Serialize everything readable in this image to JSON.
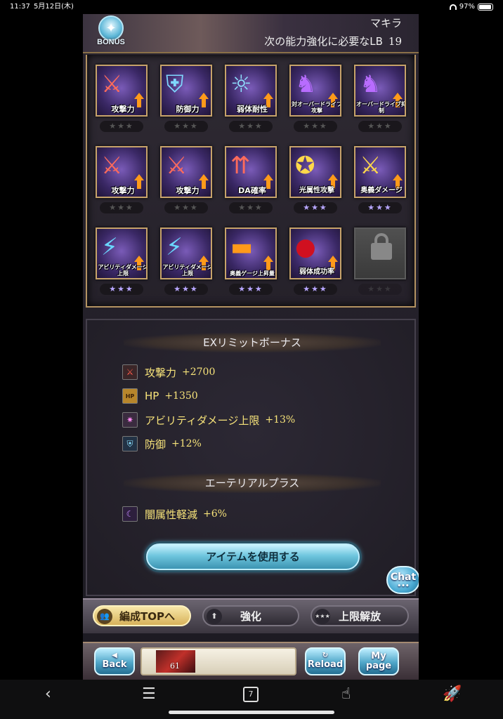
{
  "status_bar": {
    "time": "11:37",
    "date": "5月12日(木)",
    "battery": "97%",
    "battery_level": 0.97
  },
  "header": {
    "bonus_badge": "BONUS",
    "character_name": "マキラ",
    "lb_need_label": "次の能力強化に必要なLB",
    "lb_need_value": "19"
  },
  "skills": {
    "row1": [
      {
        "label": "攻撃力",
        "icon": "sword-icon",
        "stars": "★★★",
        "active": false
      },
      {
        "label": "防御力",
        "icon": "shield-icon",
        "stars": "★★★",
        "active": false
      },
      {
        "label": "弱体耐性",
        "icon": "resist-icon",
        "stars": "★★★",
        "active": false
      },
      {
        "label": "対オーバードライブ攻撃",
        "icon": "overdrive-attack-icon",
        "stars": "★★★",
        "active": false
      },
      {
        "label": "オーバードライブ抑制",
        "icon": "overdrive-suppress-icon",
        "stars": "★★★",
        "active": false
      }
    ],
    "row2": [
      {
        "label": "攻撃力",
        "icon": "sword-icon",
        "stars": "★★★",
        "active": false
      },
      {
        "label": "攻撃力",
        "icon": "sword-icon",
        "stars": "★★★",
        "active": false
      },
      {
        "label": "DA確率",
        "icon": "double-attack-icon",
        "stars": "★★★",
        "active": false
      },
      {
        "label": "光属性攻撃",
        "icon": "light-element-icon",
        "stars": "★★★",
        "active": true
      },
      {
        "label": "奥義ダメージ",
        "icon": "crossed-swords-icon",
        "stars": "★★★",
        "active": true
      }
    ],
    "row3": [
      {
        "label": "アビリティダメージ上限",
        "icon": "ability-damage-icon",
        "stars": "★★★",
        "active": true
      },
      {
        "label": "アビリティダメージ上限",
        "icon": "ability-damage-icon",
        "stars": "★★★",
        "active": true
      },
      {
        "label": "奥義ゲージ上昇量",
        "icon": "gauge-icon",
        "stars": "★★★",
        "active": true
      },
      {
        "label": "弱体成功率",
        "icon": "debuff-success-icon",
        "stars": "★★★",
        "active": true
      },
      {
        "label": "",
        "icon": "lock-icon",
        "stars": "★★★",
        "active": false,
        "locked": true
      }
    ]
  },
  "ex_bonus": {
    "title": "EXリミットボーナス",
    "items": [
      {
        "name": "攻撃力",
        "value": "+2700",
        "icon": "attack-icon"
      },
      {
        "name": "HP",
        "value": "+1350",
        "icon": "hp-icon"
      },
      {
        "name": "アビリティダメージ上限",
        "value": "+13%",
        "icon": "ability-icon"
      },
      {
        "name": "防御",
        "value": "+12%",
        "icon": "defense-icon"
      }
    ]
  },
  "ethereal": {
    "title": "エーテリアルプラス",
    "items": [
      {
        "name": "闇属性軽減",
        "value": "+6%",
        "icon": "dark-resist-icon"
      }
    ]
  },
  "use_item_button": "アイテムを使用する",
  "chat_button": "Chat",
  "tabs": {
    "formation": "編成TOPへ",
    "enhance": "強化",
    "limit_break": "上限解放"
  },
  "bottom_bar": {
    "back": "Back",
    "reload": "Reload",
    "my": "My",
    "page": "page",
    "rank": "61"
  }
}
